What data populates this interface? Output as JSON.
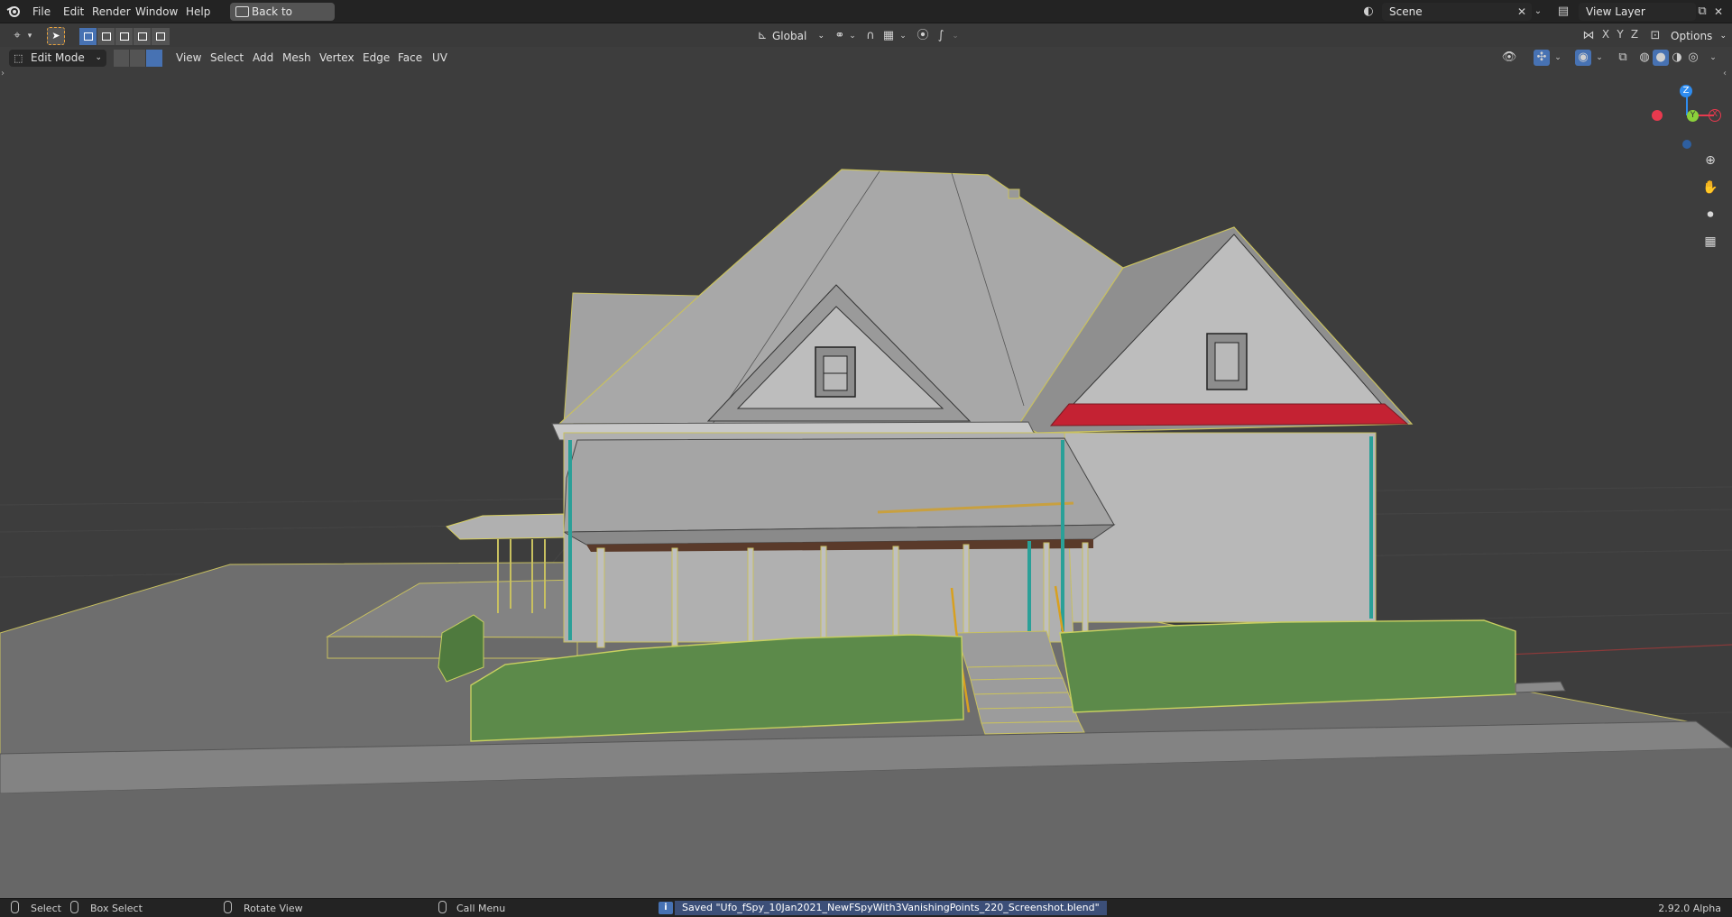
{
  "topbar": {
    "menus": [
      "File",
      "Edit",
      "Render",
      "Window",
      "Help"
    ],
    "back_button": "Back to Previous",
    "scene_name": "Scene",
    "view_layer": "View Layer"
  },
  "toolbar": {
    "orientation": "Global",
    "options_label": "Options"
  },
  "viewport_header": {
    "mode": "Edit Mode",
    "menus": [
      "View",
      "Select",
      "Add",
      "Mesh",
      "Vertex",
      "Edge",
      "Face",
      "UV"
    ],
    "axis_toggles": [
      "X",
      "Y",
      "Z"
    ]
  },
  "gizmo": {
    "z_label": "Z",
    "y_label": "Y",
    "x_label": "X",
    "colors": {
      "x": "#e8394e",
      "y": "#8bd13b",
      "z": "#2e8cf0"
    }
  },
  "status": {
    "select": "Select",
    "box_select": "Box Select",
    "rotate_view": "Rotate View",
    "call_menu": "Call Menu",
    "message": "Saved \"Ufo_fSpy_10Jan2021_NewFSpyWith3VanishingPoints_220_Screenshot.blend\"",
    "version": "2.92.0 Alpha"
  },
  "icons": {
    "blender": "blender-logo-icon",
    "viewport_nav": [
      "zoom-icon",
      "pan-hand-icon",
      "camera-icon",
      "grid-perspective-icon"
    ]
  }
}
